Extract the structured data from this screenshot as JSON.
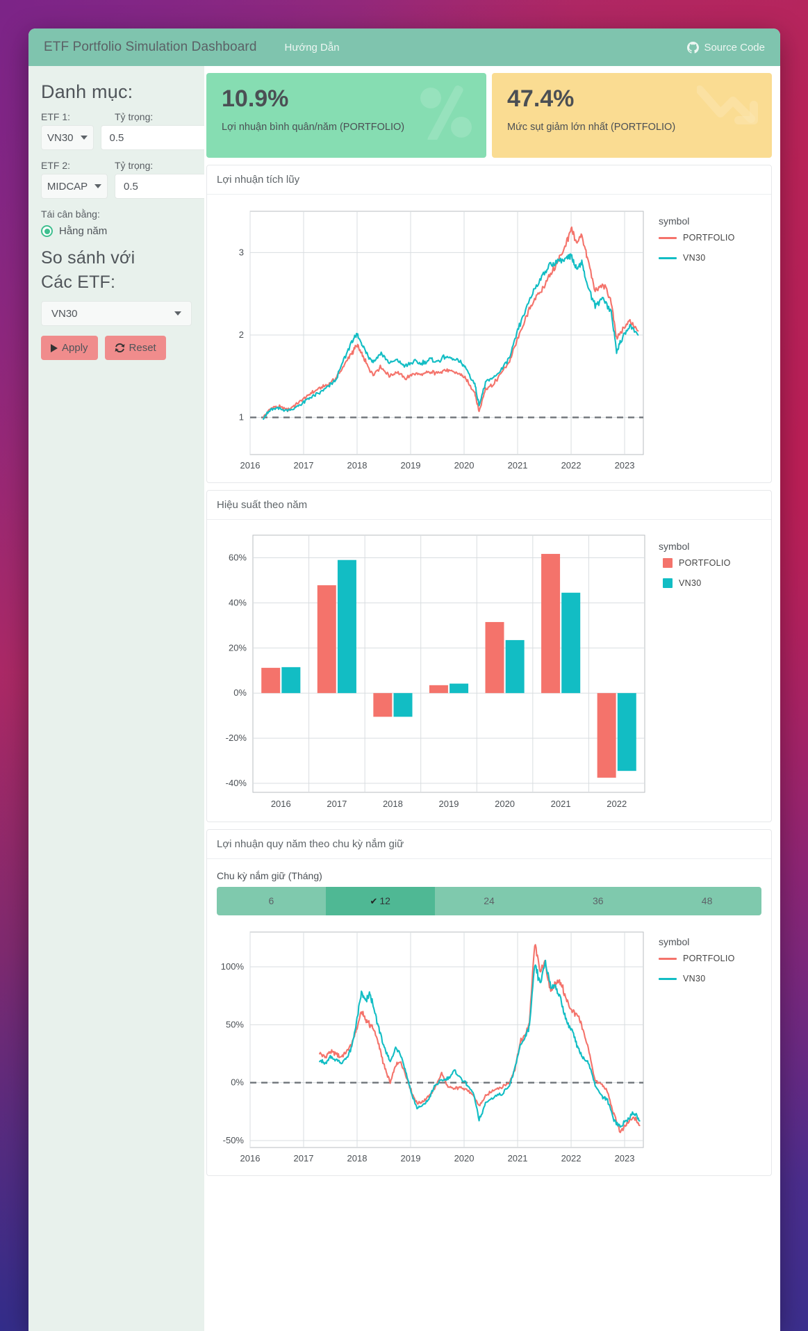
{
  "navbar": {
    "brand": "ETF Portfolio Simulation Dashboard",
    "guide_link": "Hướng Dẫn",
    "source_link": "Source Code",
    "bg_color": "#7fc4ae"
  },
  "sidebar": {
    "title": "Danh mục:",
    "etf1_label": "ETF 1:",
    "etf1_weight_label": "Tỷ trọng:",
    "etf1_value": "VN30",
    "etf1_weight_value": "0.5",
    "etf2_label": "ETF 2:",
    "etf2_weight_label": "Tỷ trọng:",
    "etf2_value": "MIDCAP",
    "etf2_weight_value": "0.5",
    "rebalance_label": "Tái cân bằng:",
    "rebalance_option": "Hằng năm",
    "compare_title": "So sánh với",
    "compare_subtitle": "Các ETF:",
    "compare_value": "VN30",
    "apply_label": "Apply",
    "reset_label": "Reset",
    "accent_color": "#f08c8c",
    "radio_color": "#3fbf8f"
  },
  "kpis": [
    {
      "value": "10.9%",
      "label": "Lợi nhuận bình quân/năm (PORTFOLIO)",
      "color": "#86ddb2",
      "icon": "percent-icon"
    },
    {
      "value": "47.4%",
      "label": "Mức sụt giảm lớn nhất (PORTFOLIO)",
      "color": "#fadc92",
      "icon": "trend-down-icon"
    }
  ],
  "panels": {
    "cumulative_title": "Lợi nhuận tích lũy",
    "annual_title": "Hiệu suất theo năm",
    "rolling_title": "Lợi nhuận quy năm theo chu kỳ nắm giữ"
  },
  "holding_period": {
    "label": "Chu kỳ nắm giữ (Tháng)",
    "options": [
      "6",
      "12",
      "24",
      "36",
      "48"
    ],
    "selected": "12",
    "check_glyph": "✔"
  },
  "colors": {
    "portfolio": "#f4736b",
    "vn30": "#12bdc4",
    "grid": "#d9dde0",
    "axis_text": "#4b5055",
    "dashed": "#6f7479"
  },
  "chart_data": [
    {
      "type": "line",
      "title": "Lợi nhuận tích lũy",
      "xlabel": "",
      "ylabel": "",
      "xticks": [
        "2016",
        "2017",
        "2018",
        "2019",
        "2020",
        "2021",
        "2022",
        "2023"
      ],
      "yticks": [
        "1",
        "2",
        "3"
      ],
      "ylim": [
        0.55,
        3.5
      ],
      "xlim": [
        2016.0,
        2023.35
      ],
      "grid": true,
      "legend_title": "symbol",
      "legend_position": "right",
      "reference_line": 1,
      "series": [
        {
          "name": "PORTFOLIO",
          "color": "#f4736b",
          "x": [
            2016.25,
            2016.4,
            2016.55,
            2016.7,
            2016.85,
            2017.0,
            2017.15,
            2017.3,
            2017.45,
            2017.6,
            2017.75,
            2017.9,
            2018.0,
            2018.1,
            2018.2,
            2018.3,
            2018.45,
            2018.6,
            2018.75,
            2018.9,
            2019.05,
            2019.2,
            2019.35,
            2019.5,
            2019.65,
            2019.8,
            2019.95,
            2020.05,
            2020.2,
            2020.28,
            2020.4,
            2020.55,
            2020.7,
            2020.85,
            2021.0,
            2021.15,
            2021.3,
            2021.45,
            2021.6,
            2021.75,
            2021.9,
            2022.0,
            2022.1,
            2022.2,
            2022.3,
            2022.45,
            2022.6,
            2022.75,
            2022.85,
            2022.95,
            2023.1,
            2023.25
          ],
          "y": [
            1.0,
            1.12,
            1.13,
            1.09,
            1.15,
            1.22,
            1.3,
            1.36,
            1.4,
            1.47,
            1.63,
            1.78,
            1.88,
            1.75,
            1.62,
            1.52,
            1.62,
            1.5,
            1.56,
            1.47,
            1.53,
            1.52,
            1.55,
            1.54,
            1.58,
            1.55,
            1.52,
            1.45,
            1.3,
            1.07,
            1.35,
            1.4,
            1.55,
            1.68,
            1.95,
            2.2,
            2.42,
            2.55,
            2.72,
            2.88,
            3.1,
            3.28,
            3.12,
            3.22,
            2.95,
            2.52,
            2.62,
            2.4,
            1.95,
            2.05,
            2.18,
            2.05
          ]
        },
        {
          "name": "VN30",
          "color": "#12bdc4",
          "x": [
            2016.25,
            2016.4,
            2016.55,
            2016.7,
            2016.85,
            2017.0,
            2017.15,
            2017.3,
            2017.45,
            2017.6,
            2017.75,
            2017.9,
            2018.0,
            2018.1,
            2018.2,
            2018.3,
            2018.45,
            2018.6,
            2018.75,
            2018.9,
            2019.05,
            2019.2,
            2019.35,
            2019.5,
            2019.65,
            2019.8,
            2019.95,
            2020.05,
            2020.2,
            2020.28,
            2020.4,
            2020.55,
            2020.7,
            2020.85,
            2021.0,
            2021.15,
            2021.3,
            2021.45,
            2021.6,
            2021.75,
            2021.9,
            2022.0,
            2022.1,
            2022.2,
            2022.3,
            2022.45,
            2022.6,
            2022.75,
            2022.85,
            2022.95,
            2023.1,
            2023.25
          ],
          "y": [
            1.0,
            1.1,
            1.11,
            1.08,
            1.12,
            1.18,
            1.25,
            1.3,
            1.37,
            1.45,
            1.7,
            1.92,
            2.0,
            1.88,
            1.75,
            1.68,
            1.78,
            1.66,
            1.7,
            1.62,
            1.68,
            1.66,
            1.7,
            1.68,
            1.74,
            1.7,
            1.66,
            1.58,
            1.4,
            1.15,
            1.42,
            1.48,
            1.58,
            1.72,
            2.05,
            2.3,
            2.55,
            2.7,
            2.85,
            2.9,
            2.92,
            2.95,
            2.82,
            2.88,
            2.62,
            2.35,
            2.45,
            2.28,
            1.8,
            1.95,
            2.12,
            2.0
          ]
        }
      ]
    },
    {
      "type": "bar",
      "title": "Hiệu suất theo năm",
      "xlabel": "",
      "ylabel": "",
      "categories": [
        "2016",
        "2017",
        "2018",
        "2019",
        "2020",
        "2021",
        "2022"
      ],
      "yticks": [
        "-40%",
        "-20%",
        "0%",
        "20%",
        "40%",
        "60%"
      ],
      "ylim": [
        -0.44,
        0.7
      ],
      "grid": true,
      "legend_title": "symbol",
      "legend_position": "right",
      "series": [
        {
          "name": "PORTFOLIO",
          "color": "#f4736b",
          "values": [
            0.112,
            0.478,
            -0.105,
            0.035,
            0.315,
            0.617,
            -0.375
          ]
        },
        {
          "name": "VN30",
          "color": "#12bdc4",
          "values": [
            0.115,
            0.59,
            -0.105,
            0.042,
            0.235,
            0.445,
            -0.345
          ]
        }
      ]
    },
    {
      "type": "line",
      "title": "Lợi nhuận quy năm theo chu kỳ nắm giữ",
      "xlabel": "",
      "ylabel": "",
      "xticks": [
        "2016",
        "2017",
        "2018",
        "2019",
        "2020",
        "2021",
        "2022",
        "2023"
      ],
      "yticks": [
        "-50%",
        "0%",
        "50%",
        "100%"
      ],
      "ylim": [
        -0.56,
        1.3
      ],
      "xlim": [
        2016.0,
        2023.35
      ],
      "grid": true,
      "legend_title": "symbol",
      "legend_position": "right",
      "reference_line": 0,
      "series": [
        {
          "name": "PORTFOLIO",
          "color": "#f4736b",
          "x": [
            2017.3,
            2017.4,
            2017.5,
            2017.6,
            2017.7,
            2017.8,
            2017.9,
            2018.0,
            2018.08,
            2018.16,
            2018.24,
            2018.32,
            2018.42,
            2018.52,
            2018.62,
            2018.72,
            2018.82,
            2018.92,
            2019.02,
            2019.12,
            2019.22,
            2019.34,
            2019.46,
            2019.58,
            2019.7,
            2019.82,
            2019.94,
            2020.06,
            2020.18,
            2020.28,
            2020.4,
            2020.55,
            2020.7,
            2020.85,
            2020.95,
            2021.05,
            2021.15,
            2021.22,
            2021.32,
            2021.42,
            2021.52,
            2021.62,
            2021.72,
            2021.82,
            2021.92,
            2022.02,
            2022.12,
            2022.22,
            2022.32,
            2022.45,
            2022.58,
            2022.68,
            2022.8,
            2022.92,
            2023.05,
            2023.18,
            2023.28
          ],
          "y": [
            0.25,
            0.22,
            0.27,
            0.25,
            0.22,
            0.26,
            0.33,
            0.48,
            0.62,
            0.55,
            0.5,
            0.46,
            0.3,
            0.12,
            0.0,
            0.15,
            0.18,
            0.05,
            -0.08,
            -0.18,
            -0.16,
            -0.12,
            -0.04,
            0.08,
            -0.04,
            -0.05,
            -0.04,
            -0.06,
            -0.12,
            -0.2,
            -0.12,
            -0.06,
            -0.04,
            0.0,
            0.12,
            0.35,
            0.42,
            0.52,
            1.2,
            0.97,
            1.02,
            0.78,
            0.88,
            0.85,
            0.7,
            0.62,
            0.58,
            0.46,
            0.3,
            0.02,
            -0.02,
            -0.08,
            -0.28,
            -0.43,
            -0.35,
            -0.3,
            -0.37
          ]
        },
        {
          "name": "VN30",
          "color": "#12bdc4",
          "x": [
            2017.3,
            2017.4,
            2017.5,
            2017.6,
            2017.7,
            2017.8,
            2017.9,
            2018.0,
            2018.08,
            2018.16,
            2018.24,
            2018.32,
            2018.42,
            2018.52,
            2018.62,
            2018.72,
            2018.82,
            2018.92,
            2019.02,
            2019.12,
            2019.22,
            2019.34,
            2019.46,
            2019.58,
            2019.7,
            2019.82,
            2019.94,
            2020.06,
            2020.18,
            2020.28,
            2020.4,
            2020.55,
            2020.7,
            2020.85,
            2020.95,
            2021.05,
            2021.15,
            2021.22,
            2021.32,
            2021.42,
            2021.52,
            2021.62,
            2021.72,
            2021.82,
            2021.92,
            2022.02,
            2022.12,
            2022.22,
            2022.32,
            2022.45,
            2022.58,
            2022.68,
            2022.8,
            2022.92,
            2023.05,
            2023.18,
            2023.28
          ],
          "y": [
            0.2,
            0.16,
            0.22,
            0.2,
            0.17,
            0.21,
            0.3,
            0.55,
            0.78,
            0.7,
            0.77,
            0.62,
            0.45,
            0.28,
            0.18,
            0.3,
            0.24,
            0.08,
            -0.1,
            -0.22,
            -0.2,
            -0.14,
            -0.02,
            0.02,
            0.04,
            0.1,
            0.04,
            -0.02,
            -0.1,
            -0.33,
            -0.18,
            -0.12,
            -0.1,
            -0.02,
            0.12,
            0.32,
            0.4,
            0.48,
            1.02,
            0.85,
            1.04,
            0.84,
            0.82,
            0.7,
            0.52,
            0.45,
            0.3,
            0.22,
            0.18,
            -0.02,
            -0.12,
            -0.15,
            -0.32,
            -0.38,
            -0.32,
            -0.26,
            -0.33
          ]
        }
      ]
    }
  ]
}
